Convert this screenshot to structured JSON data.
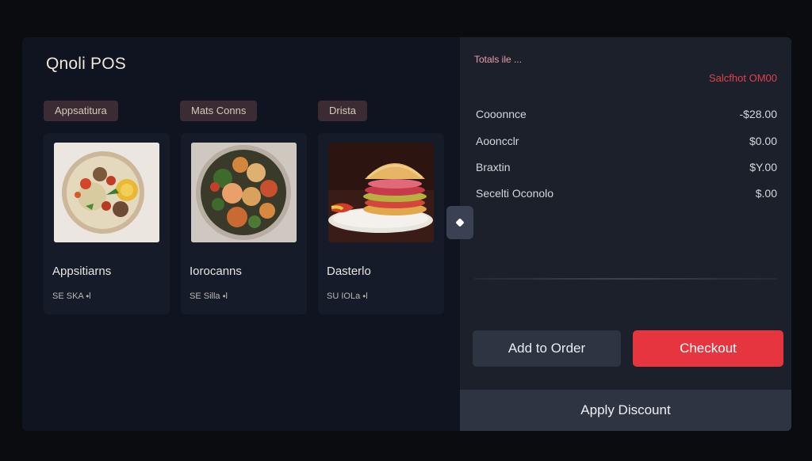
{
  "app": {
    "title": "Qnoli POS"
  },
  "categories": [
    {
      "label": "Appsatitura"
    },
    {
      "label": "Mats Conns"
    },
    {
      "label": "Drista"
    }
  ],
  "menu_items": [
    {
      "name": "Appsitiarns",
      "price": "SE SKA ⬩l",
      "image": "food-bowl-image"
    },
    {
      "name": "Iorocanns",
      "price": "SE Silla ⬩l",
      "image": "roasted-vegetables-image"
    },
    {
      "name": "Dasterlo",
      "price": "SU IOLa ⬩l",
      "image": "burger-image"
    }
  ],
  "order_summary": {
    "title": "Totals ile ...",
    "subtotal": "Salcfhot OM00",
    "rows": [
      {
        "label": "Cooonnce",
        "value": "-$28.00"
      },
      {
        "label": "Aooncclr",
        "value": "$0.00"
      },
      {
        "label": "Braxtin",
        "value": "$Y.00"
      },
      {
        "label": "Secelti Oconolo",
        "value": "$.00"
      }
    ]
  },
  "actions": {
    "add_to_order": "Add to Order",
    "checkout": "Checkout",
    "apply_discount": "Apply Discount"
  },
  "colors": {
    "accent": "#e6353e",
    "panel": "#1b202b",
    "background": "#0f1420",
    "chip": "#3a2c32"
  }
}
